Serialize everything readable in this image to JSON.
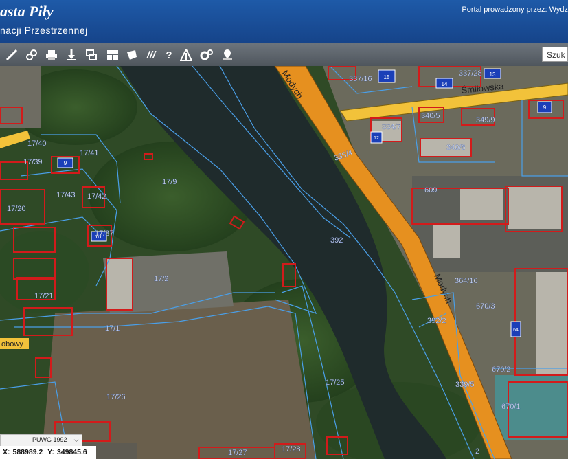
{
  "header": {
    "title_line1": "asta Piły",
    "title_line2": "nacji Przestrzennej",
    "portal_text": "Portal prowadzony przez: Wydz"
  },
  "toolbar": {
    "tools": [
      "ruler-icon",
      "link-icon",
      "print-icon",
      "download-icon",
      "layers-icon",
      "layout-icon",
      "shape-icon",
      "hatch-icon",
      "help-icon",
      "warning-icon",
      "settings-icon",
      "locate-icon"
    ],
    "help_glyph": "?",
    "hatch_glyph": "///",
    "search_placeholder": "Szuk"
  },
  "map": {
    "streets": [
      "Śmiłowska",
      "Modych",
      "Modych",
      "obowy"
    ],
    "parcels": [
      "17/40",
      "17/41",
      "17/39",
      "17/43",
      "17/42",
      "17/20",
      "17/37",
      "17/21",
      "17/9",
      "17/2",
      "17/1",
      "17/25",
      "17/26",
      "17/27",
      "17/28",
      "337/16",
      "337/28",
      "335/4",
      "334/7",
      "340/6",
      "340/5",
      "349/9",
      "609",
      "392",
      "364/16",
      "670/3",
      "392/2",
      "670/2",
      "670/1",
      "339/5",
      "2"
    ],
    "building_numbers": [
      "15",
      "14",
      "13",
      "12",
      "9",
      "9",
      "61",
      "64"
    ]
  },
  "projection": {
    "label": "PUWG 1992",
    "dropdown_glyph": "⌵"
  },
  "coords": {
    "x_label": "X:",
    "x_value": "588989.2",
    "y_label": "Y:",
    "y_value": "349845.6"
  }
}
